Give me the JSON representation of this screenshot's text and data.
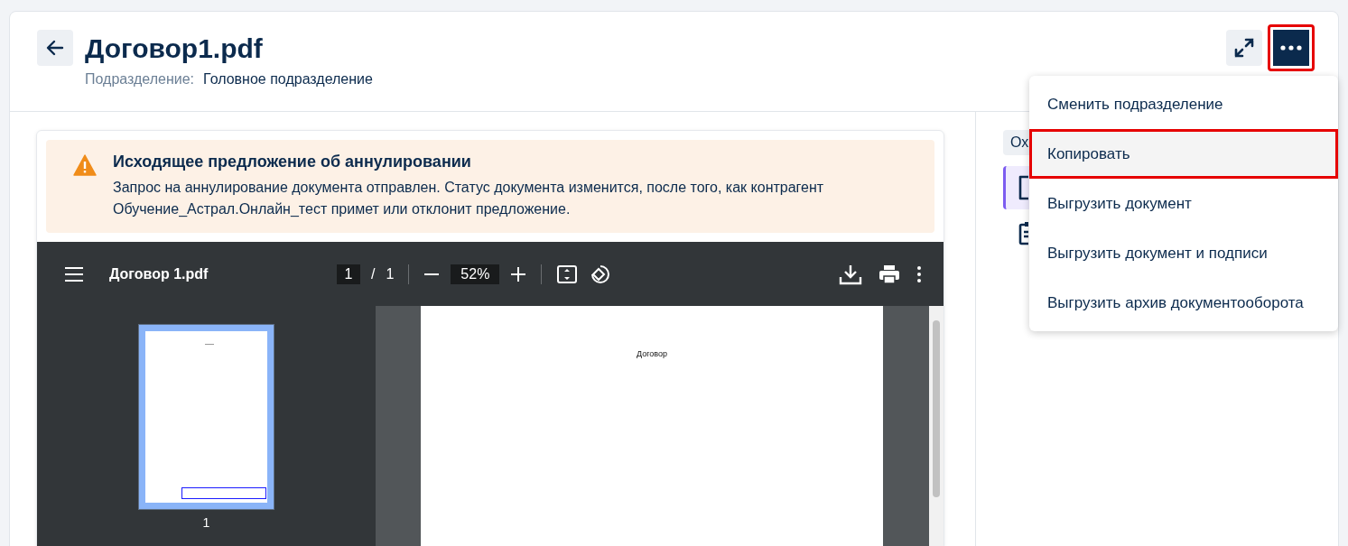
{
  "header": {
    "title": "Договор1.pdf",
    "department_label": "Подразделение:",
    "department_value": "Головное подразделение"
  },
  "more_button": {
    "highlighted": true
  },
  "menu": [
    {
      "label": "Сменить подразделение",
      "highlighted": false
    },
    {
      "label": "Копировать",
      "highlighted": true
    },
    {
      "label": "Выгрузить документ",
      "highlighted": false
    },
    {
      "label": "Выгрузить документ и подписи",
      "highlighted": false
    },
    {
      "label": "Выгрузить архив документооборота",
      "highlighted": false
    }
  ],
  "alert": {
    "title": "Исходящее предложение об аннулировании",
    "text": "Запрос на аннулирование документа отправлен. Статус документа изменится, после того, как контрагент Обучение_Астрал.Онлайн_тест примет или отклонит предложение."
  },
  "pdf_viewer": {
    "file_name": "Договор 1.pdf",
    "page": "1",
    "page_sep": "/",
    "page_total": "1",
    "zoom": "52%",
    "thumbnail_number": "1",
    "page_heading": "Договор"
  },
  "side_panel": {
    "chip": "Ох",
    "tabs": [
      {
        "kind": "document",
        "selected": true
      },
      {
        "kind": "clipboard",
        "selected": false
      }
    ]
  }
}
